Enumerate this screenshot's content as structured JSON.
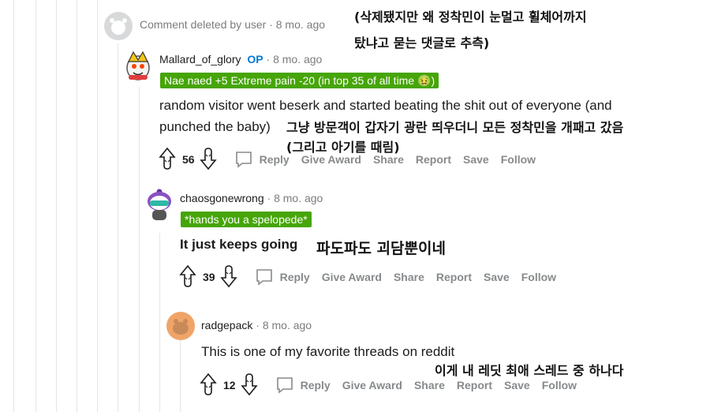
{
  "deleted": {
    "text": "Comment deleted by user",
    "time": "· 8 mo. ago"
  },
  "comments": [
    {
      "author": "Mallard_of_glory",
      "op_label": "OP",
      "time": "· 8 mo. ago",
      "flair": "Nae naed +5 Extreme pain -20 (in top 35 of all time 🤢)",
      "body_line1": "random visitor went beserk and started beating the shit out of everyone (and",
      "body_line2": "punched the baby)",
      "votes": "56"
    },
    {
      "author": "chaosgonewrong",
      "time": "· 8 mo. ago",
      "flair": "*hands you a spelopede*",
      "body": "It just keeps going",
      "votes": "39"
    },
    {
      "author": "radgepack",
      "time": "· 8 mo. ago",
      "body": "This is one of my favorite threads on reddit",
      "votes": "12"
    }
  ],
  "actions": {
    "reply": "Reply",
    "give_award": "Give Award",
    "share": "Share",
    "report": "Report",
    "save": "Save",
    "follow": "Follow"
  },
  "annotations": {
    "a1_line1": "(삭제됐지만 왜 정착민이 눈멀고 휠체어까지",
    "a1_line2": "탔냐고 묻는 댓글로 추측)",
    "a2_line1": "그냥 방문객이 갑자기 광란 띄우더니 모든 정착민을 개패고 갔음",
    "a2_line2": "(그리고 아기를 때림)",
    "a3": "파도파도 괴담뿐이네",
    "a4": "이게 내 레딧 최애 스레드 중 하나다"
  },
  "colors": {
    "flair_bg": "#46a508",
    "op_blue": "#0079d3",
    "meta_gray": "#7c7c7c",
    "action_gray": "#878a8c"
  }
}
